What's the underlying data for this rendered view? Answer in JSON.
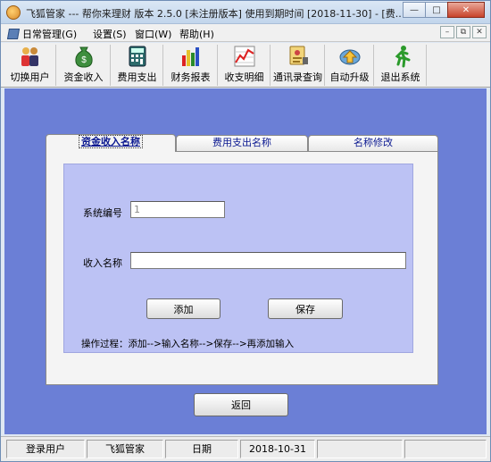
{
  "window": {
    "title": "飞狐管家 --- 帮你来理财    版本 2.5.0 [未注册版本]  使用到期时间 [2018-11-30] - [费..."
  },
  "menu": {
    "items": [
      {
        "label": "日常管理(G)"
      },
      {
        "label": "设置(S)"
      },
      {
        "label": "窗口(W)"
      },
      {
        "label": "帮助(H)"
      }
    ]
  },
  "toolbar": {
    "items": [
      {
        "label": "切换用户",
        "icon": "switch-user-icon"
      },
      {
        "label": "资金收入",
        "icon": "money-bag-icon"
      },
      {
        "label": "费用支出",
        "icon": "calculator-icon"
      },
      {
        "label": "财务报表",
        "icon": "bar-chart-icon"
      },
      {
        "label": "收支明细",
        "icon": "line-chart-icon"
      },
      {
        "label": "通讯录查询",
        "icon": "contact-card-icon"
      },
      {
        "label": "自动升级",
        "icon": "upgrade-icon"
      },
      {
        "label": "退出系统",
        "icon": "running-man-icon"
      }
    ]
  },
  "tabs": [
    {
      "label": "资金收入名称"
    },
    {
      "label": "费用支出名称"
    },
    {
      "label": "名称修改"
    }
  ],
  "form": {
    "id_label": "系统编号",
    "id_value": "1",
    "name_label": "收入名称",
    "name_value": "",
    "add_button": "添加",
    "save_button": "保存",
    "hint": "操作过程：添加-->输入名称-->保存-->再添加输入"
  },
  "back_button": "返回",
  "status": {
    "cells": [
      "登录用户",
      "飞狐管家",
      "日期",
      "2018-10-31",
      "",
      ""
    ]
  },
  "colors": {
    "main_bg": "#6b7fd6",
    "inner_bg": "#bcc2f4",
    "tab_text": "#0a1890"
  }
}
